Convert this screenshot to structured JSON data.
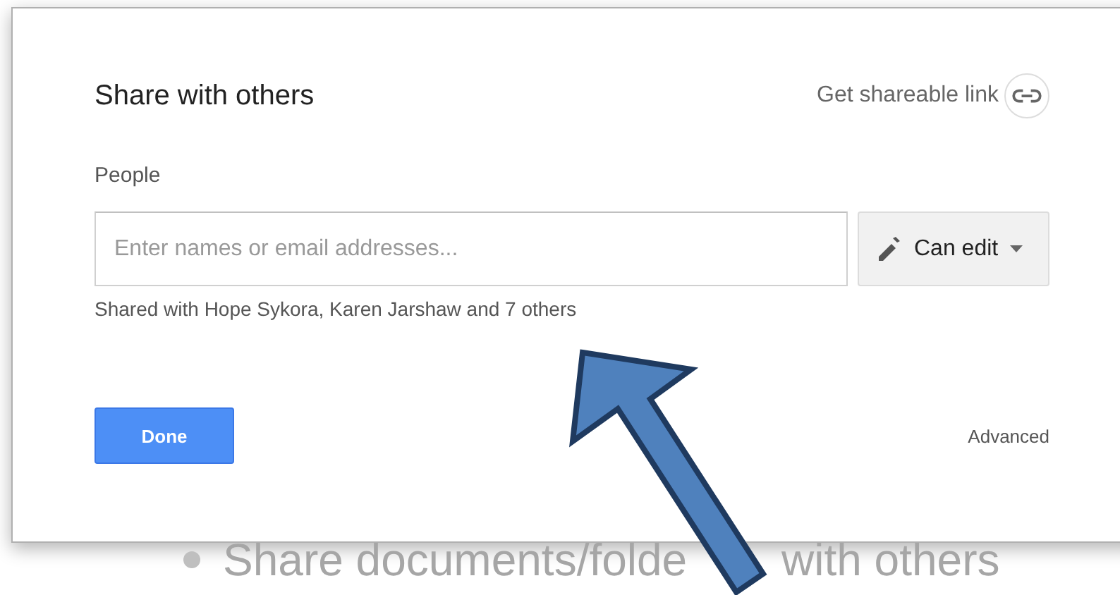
{
  "slide": {
    "bullet_parts": [
      "Share documents/folde",
      "with others"
    ]
  },
  "dialog": {
    "title": "Share with others",
    "shareable_link": "Get shareable link",
    "people_label": "People",
    "people_field": {
      "placeholder": "Enter names or email addresses..."
    },
    "permission": "Can edit",
    "shared_with": "Shared with Hope Sykora, Karen Jarshaw and 7 others",
    "done": "Done",
    "advanced": "Advanced"
  }
}
